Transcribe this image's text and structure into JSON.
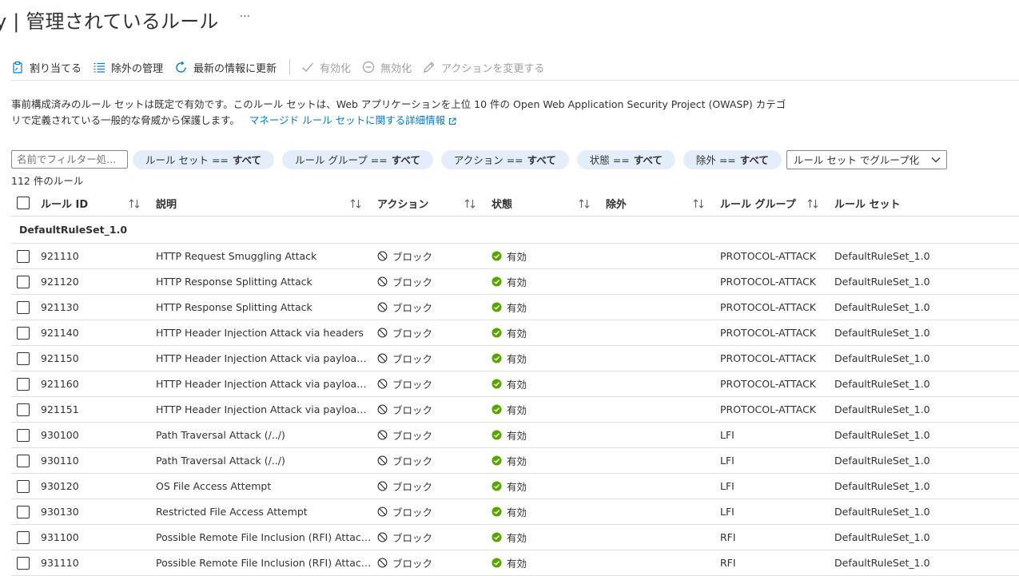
{
  "header": {
    "title": "y | 管理されているルール",
    "more_label": "···"
  },
  "toolbar": {
    "assign": "割り当てる",
    "exclusions": "除外の管理",
    "refresh": "最新の情報に更新",
    "enable": "有効化",
    "disable": "無効化",
    "change_action": "アクションを変更する"
  },
  "description": {
    "text": "事前構成済みのルール セットは既定で有効です。このルール セットは、Web アプリケーションを上位 10 件の Open Web Application Security Project (OWASP) カテゴリで定義されている一般的な脅威から保護します。",
    "link": "マネージド ルール セットに関する詳細情報"
  },
  "filters": {
    "placeholder": "名前でフィルター処...",
    "pills": [
      {
        "label": "ルール セット ==",
        "value": "すべて"
      },
      {
        "label": "ルール グループ ==",
        "value": "すべて"
      },
      {
        "label": "アクション ==",
        "value": "すべて"
      },
      {
        "label": "状態 ==",
        "value": "すべて"
      },
      {
        "label": "除外 ==",
        "value": "すべて"
      }
    ],
    "group_by": "ルール セット でグループ化"
  },
  "count_label": "112 件のルール",
  "columns": {
    "rule_id": "ルール ID",
    "description": "説明",
    "action": "アクション",
    "status": "状態",
    "exclusion": "除外",
    "rule_group": "ルール グループ",
    "rule_set": "ルール セット"
  },
  "group_name": "DefaultRuleSet_1.0",
  "colors": {
    "accent": "#0078d4",
    "success": "#57a300",
    "pill_bg": "#e3eefa"
  },
  "rows": [
    {
      "id": "921110",
      "description": "HTTP Request Smuggling Attack",
      "action": "ブロック",
      "status": "有効",
      "group": "PROTOCOL-ATTACK",
      "set": "DefaultRuleSet_1.0"
    },
    {
      "id": "921120",
      "description": "HTTP Response Splitting Attack",
      "action": "ブロック",
      "status": "有効",
      "group": "PROTOCOL-ATTACK",
      "set": "DefaultRuleSet_1.0"
    },
    {
      "id": "921130",
      "description": "HTTP Response Splitting Attack",
      "action": "ブロック",
      "status": "有効",
      "group": "PROTOCOL-ATTACK",
      "set": "DefaultRuleSet_1.0"
    },
    {
      "id": "921140",
      "description": "HTTP Header Injection Attack via headers",
      "action": "ブロック",
      "status": "有効",
      "group": "PROTOCOL-ATTACK",
      "set": "DefaultRuleSet_1.0"
    },
    {
      "id": "921150",
      "description": "HTTP Header Injection Attack via payload (C...",
      "action": "ブロック",
      "status": "有効",
      "group": "PROTOCOL-ATTACK",
      "set": "DefaultRuleSet_1.0"
    },
    {
      "id": "921160",
      "description": "HTTP Header Injection Attack via payload (C...",
      "action": "ブロック",
      "status": "有効",
      "group": "PROTOCOL-ATTACK",
      "set": "DefaultRuleSet_1.0"
    },
    {
      "id": "921151",
      "description": "HTTP Header Injection Attack via payload (C...",
      "action": "ブロック",
      "status": "有効",
      "group": "PROTOCOL-ATTACK",
      "set": "DefaultRuleSet_1.0"
    },
    {
      "id": "930100",
      "description": "Path Traversal Attack (/../)",
      "action": "ブロック",
      "status": "有効",
      "group": "LFI",
      "set": "DefaultRuleSet_1.0"
    },
    {
      "id": "930110",
      "description": "Path Traversal Attack (/../)",
      "action": "ブロック",
      "status": "有効",
      "group": "LFI",
      "set": "DefaultRuleSet_1.0"
    },
    {
      "id": "930120",
      "description": "OS File Access Attempt",
      "action": "ブロック",
      "status": "有効",
      "group": "LFI",
      "set": "DefaultRuleSet_1.0"
    },
    {
      "id": "930130",
      "description": "Restricted File Access Attempt",
      "action": "ブロック",
      "status": "有効",
      "group": "LFI",
      "set": "DefaultRuleSet_1.0"
    },
    {
      "id": "931100",
      "description": "Possible Remote File Inclusion (RFI) Attack: U...",
      "action": "ブロック",
      "status": "有効",
      "group": "RFI",
      "set": "DefaultRuleSet_1.0"
    },
    {
      "id": "931110",
      "description": "Possible Remote File Inclusion (RFI) Attack: C...",
      "action": "ブロック",
      "status": "有効",
      "group": "RFI",
      "set": "DefaultRuleSet_1.0"
    }
  ]
}
